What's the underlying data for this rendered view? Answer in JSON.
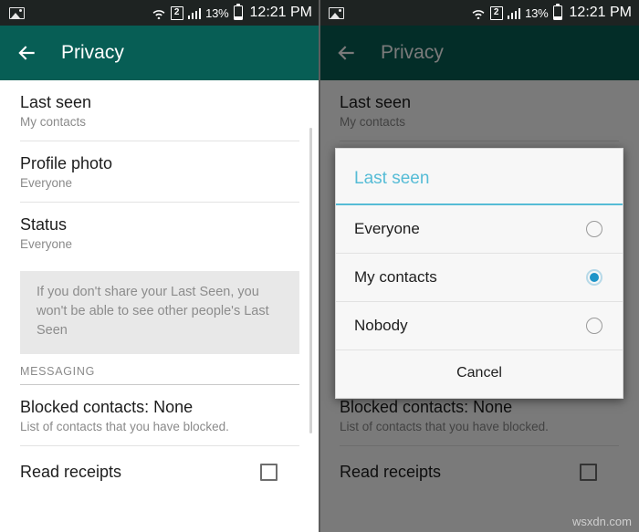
{
  "status_bar": {
    "image_icon": "image-icon",
    "wifi_icon": "wifi-icon",
    "sim_icon_label": "2",
    "signal_icon": "signal-bars-icon",
    "battery_percent": "13%",
    "battery_icon": "battery-icon",
    "clock": "12:21 PM"
  },
  "app_bar": {
    "back_icon": "back-arrow-icon",
    "title": "Privacy"
  },
  "settings": {
    "rows": [
      {
        "title": "Last seen",
        "subtitle": "My contacts"
      },
      {
        "title": "Profile photo",
        "subtitle": "Everyone"
      },
      {
        "title": "Status",
        "subtitle": "Everyone"
      }
    ],
    "info_note": "If you don't share your Last Seen, you won't be able to see other people's Last Seen",
    "section_header": "MESSAGING",
    "blocked": {
      "title": "Blocked contacts: None",
      "subtitle": "List of contacts that you have blocked."
    },
    "read_receipts": {
      "label": "Read receipts",
      "checked": false
    }
  },
  "dialog": {
    "title": "Last seen",
    "options": [
      {
        "label": "Everyone",
        "selected": false
      },
      {
        "label": "My contacts",
        "selected": true
      },
      {
        "label": "Nobody",
        "selected": false
      }
    ],
    "cancel_label": "Cancel"
  },
  "watermark": "wsxdn.com",
  "colors": {
    "app_bar_green": "#075e55",
    "status_bar": "#1e2322",
    "dialog_accent": "#56bcd6",
    "radio_selected": "#1e94c8",
    "info_box": "#e8e8e8"
  }
}
